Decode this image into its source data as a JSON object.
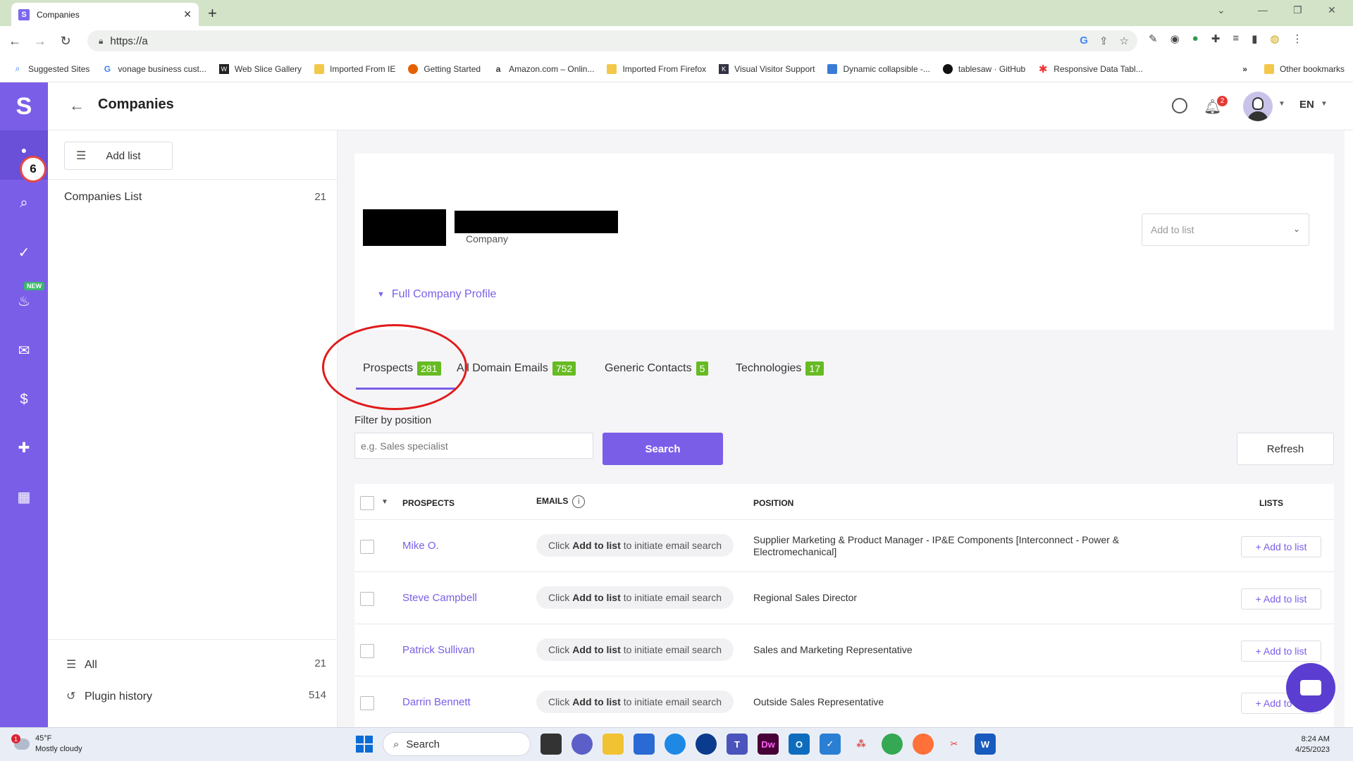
{
  "browser": {
    "tab_title": "Companies",
    "url": "https://⁠a"
  },
  "bookmarks": [
    "Suggested Sites",
    "vonage business cust...",
    "Web Slice Gallery",
    "Imported From IE",
    "Getting Started",
    "Amazon.com – Onlin...",
    "Imported From Firefox",
    "Visual Visitor Support",
    "Dynamic collapsible -...",
    "tablesaw · GitHub",
    "Responsive Data Tabl..."
  ],
  "bookmarks_overflow": "»",
  "other_bookmarks": "Other bookmarks",
  "rail": {
    "logo": "S",
    "badge_count": "6",
    "new_label": "NEW"
  },
  "header": {
    "title": "Companies",
    "notif_count": "2",
    "lang": "EN"
  },
  "lists_panel": {
    "add_list_label": "Add list",
    "lists": [
      {
        "name": "Companies List",
        "count": "21"
      }
    ],
    "footer": [
      {
        "name": "All",
        "count": "21"
      },
      {
        "name": "Plugin history",
        "count": "514"
      }
    ]
  },
  "company": {
    "subtitle": "Company",
    "add_to_list_placeholder": "Add to list",
    "full_profile_label": "Full Company Profile"
  },
  "tabs": [
    {
      "label": "Prospects",
      "count": "281"
    },
    {
      "label": "All Domain Emails",
      "count": "752"
    },
    {
      "label": "Generic Contacts",
      "count": "5"
    },
    {
      "label": "Technologies",
      "count": "17"
    }
  ],
  "filter": {
    "label": "Filter by position",
    "placeholder": "e.g. Sales specialist",
    "search_label": "Search",
    "refresh_label": "Refresh"
  },
  "table": {
    "headers": {
      "prospects": "PROSPECTS",
      "emails": "EMAILS",
      "position": "POSITION",
      "lists": "LISTS"
    },
    "email_hint": {
      "pre": "Click",
      "bold": "Add to list",
      "post": "to initiate email search"
    },
    "add_to_list_label": "+ Add to list",
    "rows": [
      {
        "name": "Mike O.",
        "position": "Supplier Marketing & Product Manager - IP&E Components [Interconnect - Power & Electromechanical]"
      },
      {
        "name": "Steve Campbell",
        "position": "Regional Sales Director"
      },
      {
        "name": "Patrick Sullivan",
        "position": "Sales and Marketing Representative"
      },
      {
        "name": "Darrin Bennett",
        "position": "Outside Sales Representative"
      }
    ]
  },
  "taskbar": {
    "weather_temp": "45°F",
    "weather_desc": "Mostly cloudy",
    "weather_alert": "1",
    "search_label": "Search",
    "time": "8:24 AM",
    "date": "4/25/2023"
  },
  "colors": {
    "brand": "#7b5ee8",
    "badge": "#66bb22",
    "annotation": "#e01b1b"
  }
}
